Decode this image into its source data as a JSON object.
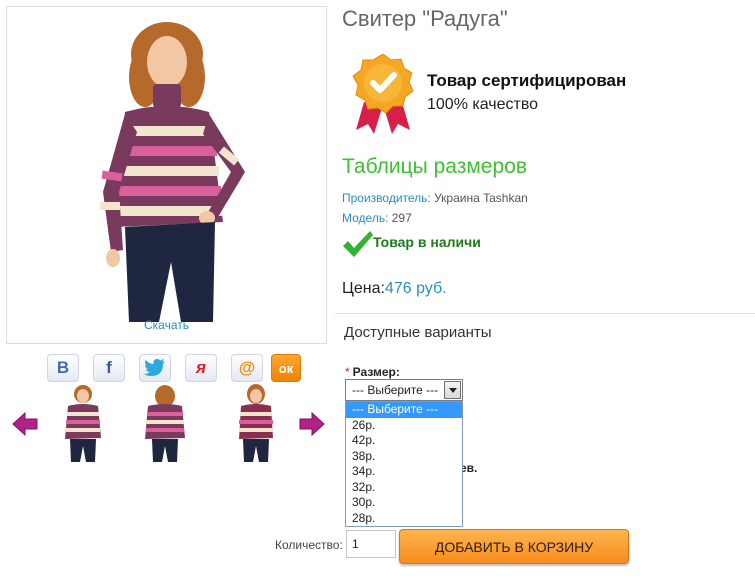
{
  "product": {
    "title": "Свитер \"Радуга\"",
    "download_label": "Скачать"
  },
  "certificate": {
    "title": "Товар сертифицирован",
    "subtitle": "100% качество"
  },
  "size_tables_label": "Таблицы размеров",
  "meta": {
    "manufacturer_key": "Производитель:",
    "manufacturer_value": " Украина Tashkan",
    "model_key": "Модель:",
    "model_value": " 297"
  },
  "stock_text": "Товар в наличи",
  "price": {
    "label": "Цена:",
    "value": "476 руб."
  },
  "variants": {
    "title": "Доступные варианты",
    "size_label": "Размер:",
    "required_mark": "*",
    "selected": "--- Выберите ---",
    "options": [
      "--- Выберите ---",
      "26р.",
      "42р.",
      "38р.",
      "34р.",
      "32р.",
      "30р.",
      "28р."
    ]
  },
  "partially_hidden_text": "ев.",
  "cart": {
    "quantity_label": "Количество:",
    "quantity_value": "1",
    "add_label": "ДОБАВИТЬ В КОРЗИНУ"
  },
  "share": {
    "vk": "В",
    "facebook": "f",
    "twitter_icon": "twitter-bird-icon",
    "yaru": "я",
    "mailru": "@",
    "ok": "ок"
  },
  "colors": {
    "accent_blue": "#2a8fbd",
    "green": "#3dc133",
    "orange": "#f68c1e"
  }
}
